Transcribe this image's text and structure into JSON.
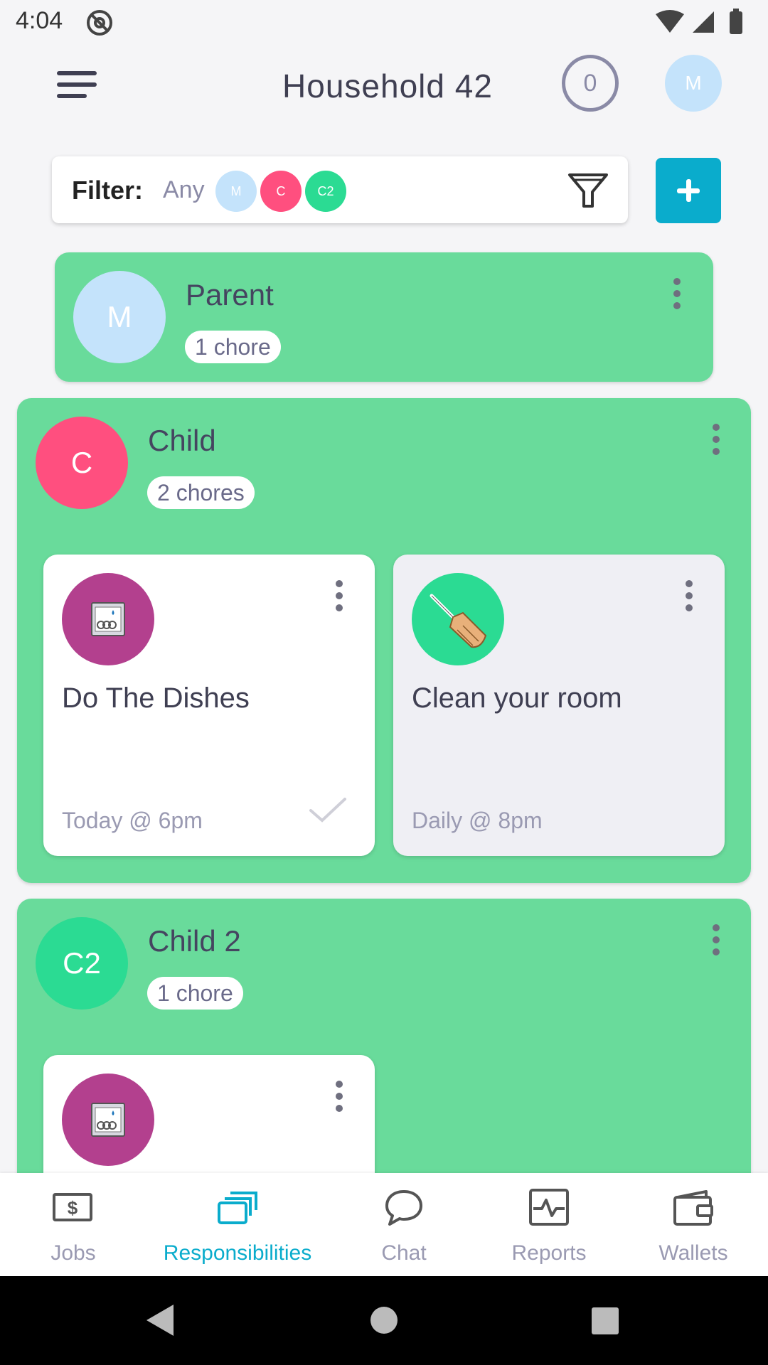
{
  "status_bar": {
    "time": "4:04"
  },
  "header": {
    "title": "Household 42",
    "counter": "0",
    "avatar_initial": "M"
  },
  "filter": {
    "label": "Filter:",
    "any_label": "Any",
    "chips": [
      {
        "initial": "M",
        "color": "#c4e3fb"
      },
      {
        "initial": "C",
        "color": "#ff4f7f"
      },
      {
        "initial": "C2",
        "color": "#2bdb93"
      }
    ]
  },
  "members": [
    {
      "name": "Parent",
      "initial": "M",
      "avatar_color": "#c4e3fb",
      "chore_count": "1 chore"
    },
    {
      "name": "Child",
      "initial": "C",
      "avatar_color": "#ff4f7f",
      "chore_count": "2 chores",
      "chores": [
        {
          "title": "Do The Dishes",
          "time": "Today @ 6pm",
          "icon": "dishwasher-icon",
          "icon_bg": "#b3408e",
          "card_bg": "#ffffff",
          "completed": true
        },
        {
          "title": "Clean your room",
          "time": "Daily @ 8pm",
          "icon": "broom-icon",
          "icon_bg": "#2bdb93",
          "card_bg": "#efeff4",
          "completed": false
        }
      ]
    },
    {
      "name": "Child 2",
      "initial": "C2",
      "avatar_color": "#2bdb93",
      "chore_count": "1 chore",
      "chores": [
        {
          "title": "",
          "time": "",
          "icon": "dishwasher-icon",
          "icon_bg": "#b3408e",
          "card_bg": "#ffffff"
        }
      ]
    }
  ],
  "bottom_nav": [
    {
      "label": "Jobs",
      "icon": "dollar-bill-icon",
      "active": false
    },
    {
      "label": "Responsibilities",
      "icon": "cards-stack-icon",
      "active": true
    },
    {
      "label": "Chat",
      "icon": "chat-bubble-icon",
      "active": false
    },
    {
      "label": "Reports",
      "icon": "pulse-chart-icon",
      "active": false
    },
    {
      "label": "Wallets",
      "icon": "wallet-icon",
      "active": false
    }
  ],
  "colors": {
    "accent": "#0aaccc",
    "member_card": "#69db9b",
    "nav_inactive": "#9a9ab2"
  }
}
